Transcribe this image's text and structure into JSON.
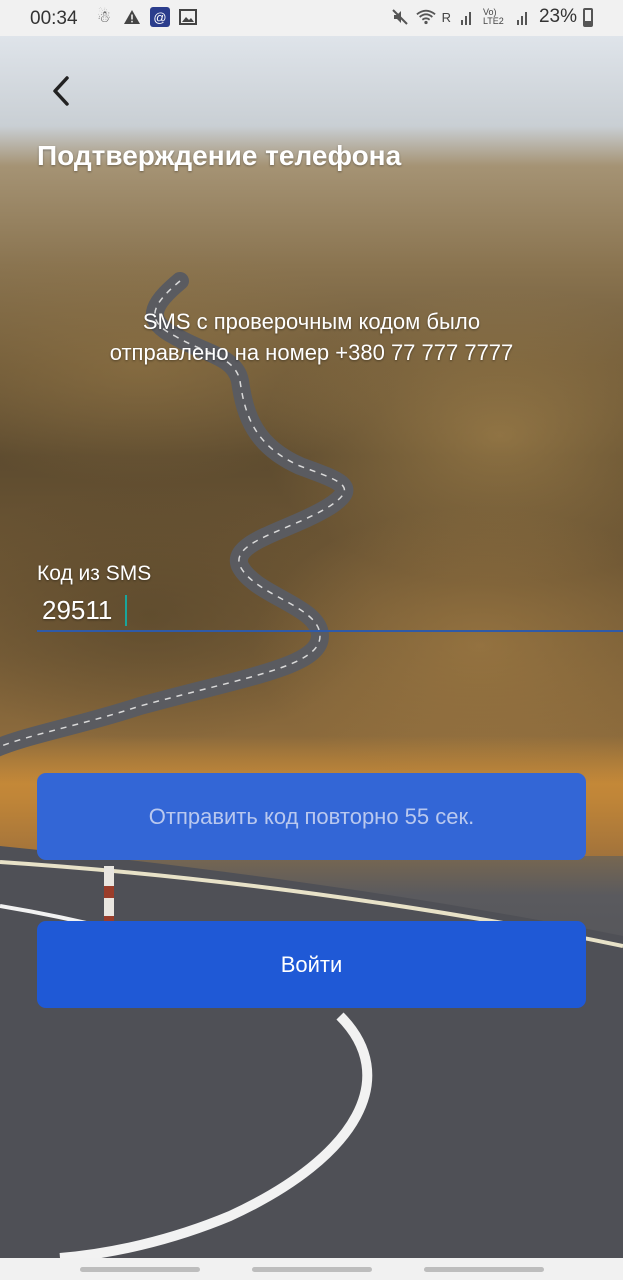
{
  "status_bar": {
    "time": "00:34",
    "battery": "23%",
    "left_icons": [
      "tracking-icon",
      "warning-icon",
      "app-notification-icon",
      "image-icon"
    ],
    "right_icons": [
      "mute-icon",
      "wifi-icon",
      "signal-icon",
      "volte-icon",
      "signal-icon-2",
      "battery-icon"
    ],
    "network_label_1": "R",
    "network_label_2": "Vo) LTE2"
  },
  "header": {
    "back_icon": "chevron-left-icon",
    "title": "Подтверждение телефона"
  },
  "message": {
    "line1": "SMS с проверочным кодом было",
    "line2": "отправлено на номер +380 77 777 7777"
  },
  "code_field": {
    "label": "Код из SMS",
    "value": "29511"
  },
  "buttons": {
    "resend": "Отправить код повторно 55 сек.",
    "login": "Войти"
  },
  "colors": {
    "primary": "#1f59d6",
    "disabled_button": "#3366d6",
    "input_underline": "#2f5aa8",
    "cursor": "#1aa59b"
  }
}
